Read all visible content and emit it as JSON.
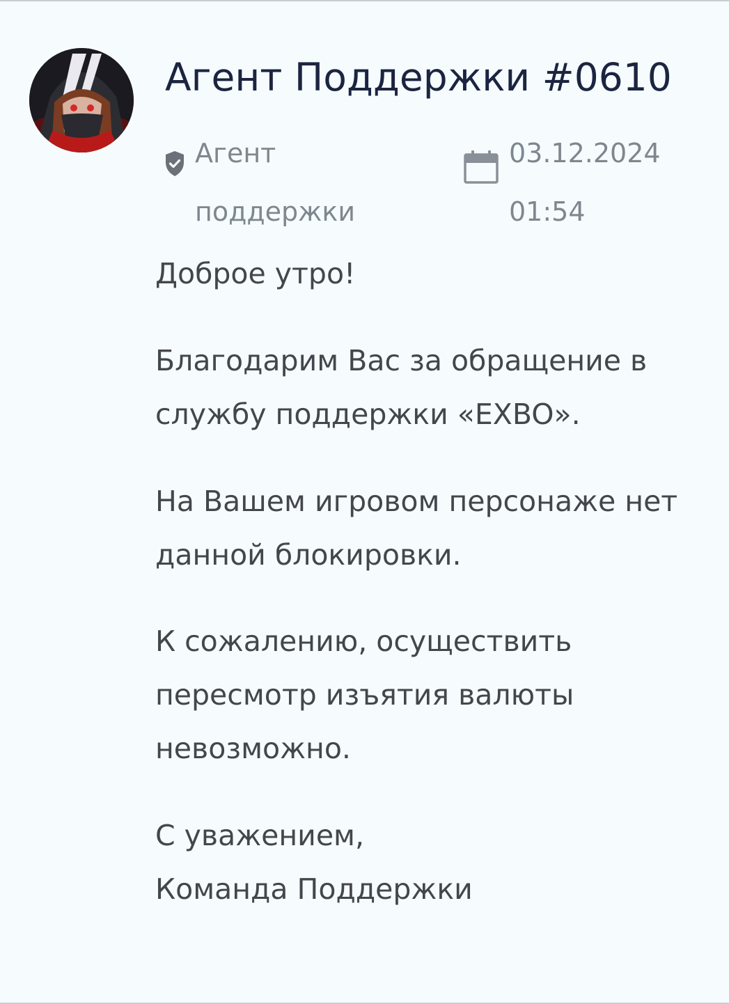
{
  "post": {
    "author_name": "Агент Поддержки #0610",
    "role_line1": "Агент",
    "role_line2": "поддержки",
    "date": "03.12.2024",
    "time": "01:54"
  },
  "message": {
    "greeting": "Доброе утро!",
    "p1_line1": "Благодарим Вас за обращение в",
    "p1_line2": "службу поддержки «EXBO».",
    "p2_line1": "На Вашем игровом персонаже нет",
    "p2_line2": "данной блокировки.",
    "p3_line1": "К сожалению, осуществить",
    "p3_line2": "пересмотр изъятия валюты",
    "p3_line3": "невозможно.",
    "sign_line1": "С уважением,",
    "sign_line2": "Команда Поддержки"
  },
  "icons": {
    "role": "shield-check-icon",
    "date": "calendar-icon"
  },
  "colors": {
    "background": "#f6fcfd",
    "title": "#1b2440",
    "meta": "#7f868e",
    "body_text": "#43474d"
  }
}
